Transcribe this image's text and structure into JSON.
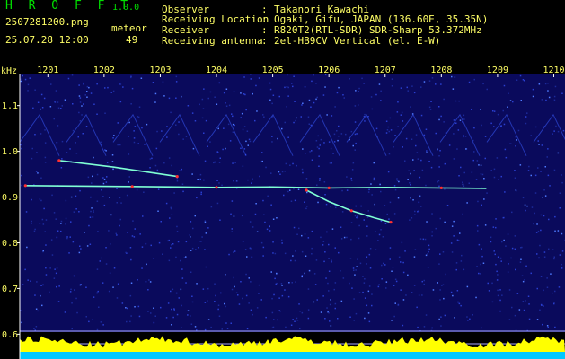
{
  "header": {
    "app_name": "H R O F F T",
    "app_version": "1.0.0",
    "file_name": "2507281200.png",
    "datetime": "25.07.28 12:00",
    "mode_label": "meteor",
    "count": "49"
  },
  "info": {
    "rows": [
      {
        "key": "Observer",
        "value": "Takanori Kawachi"
      },
      {
        "key": "Receiving Location",
        "value": "Ogaki, Gifu, JAPAN (136.60E, 35.35N)"
      },
      {
        "key": "Receiver",
        "value": "R820T2(RTL-SDR) SDR-Sharp 53.372MHz"
      },
      {
        "key": "Receiving antenna",
        "value": "2el-HB9CV Vertical (el. E-W)"
      }
    ]
  },
  "chart_data": {
    "type": "heatmap",
    "ylabel": "kHz",
    "x_ticks": [
      "1201",
      "1202",
      "1203",
      "1204",
      "1205",
      "1206",
      "1207",
      "1208",
      "1209",
      "1210"
    ],
    "y_ticks": [
      1.1,
      1.0,
      0.9,
      0.8,
      0.7,
      0.6
    ],
    "ylim": [
      0.585,
      1.17
    ],
    "xlim": [
      1200.5,
      1210.2
    ],
    "grid": false,
    "colors": {
      "background": "#0a0a5c",
      "noise": "#2a3fd0",
      "echo": "#7fffd4",
      "hot": "#ff3030",
      "level": "#ffff00",
      "base": "#00c8ff"
    },
    "traces": [
      {
        "x": [
          1200.6,
          1201.5,
          1202.5,
          1203.3,
          1204.0,
          1205.0,
          1206.0,
          1207.0,
          1208.0,
          1208.8
        ],
        "y": [
          0.925,
          0.924,
          0.923,
          0.922,
          0.921,
          0.922,
          0.92,
          0.921,
          0.92,
          0.919
        ]
      },
      {
        "x": [
          1201.2,
          1202.2,
          1203.3
        ],
        "y": [
          0.98,
          0.965,
          0.945
        ]
      },
      {
        "x": [
          1205.6,
          1206.0,
          1206.4,
          1206.8,
          1207.1
        ],
        "y": [
          0.915,
          0.89,
          0.87,
          0.855,
          0.845
        ]
      }
    ]
  }
}
